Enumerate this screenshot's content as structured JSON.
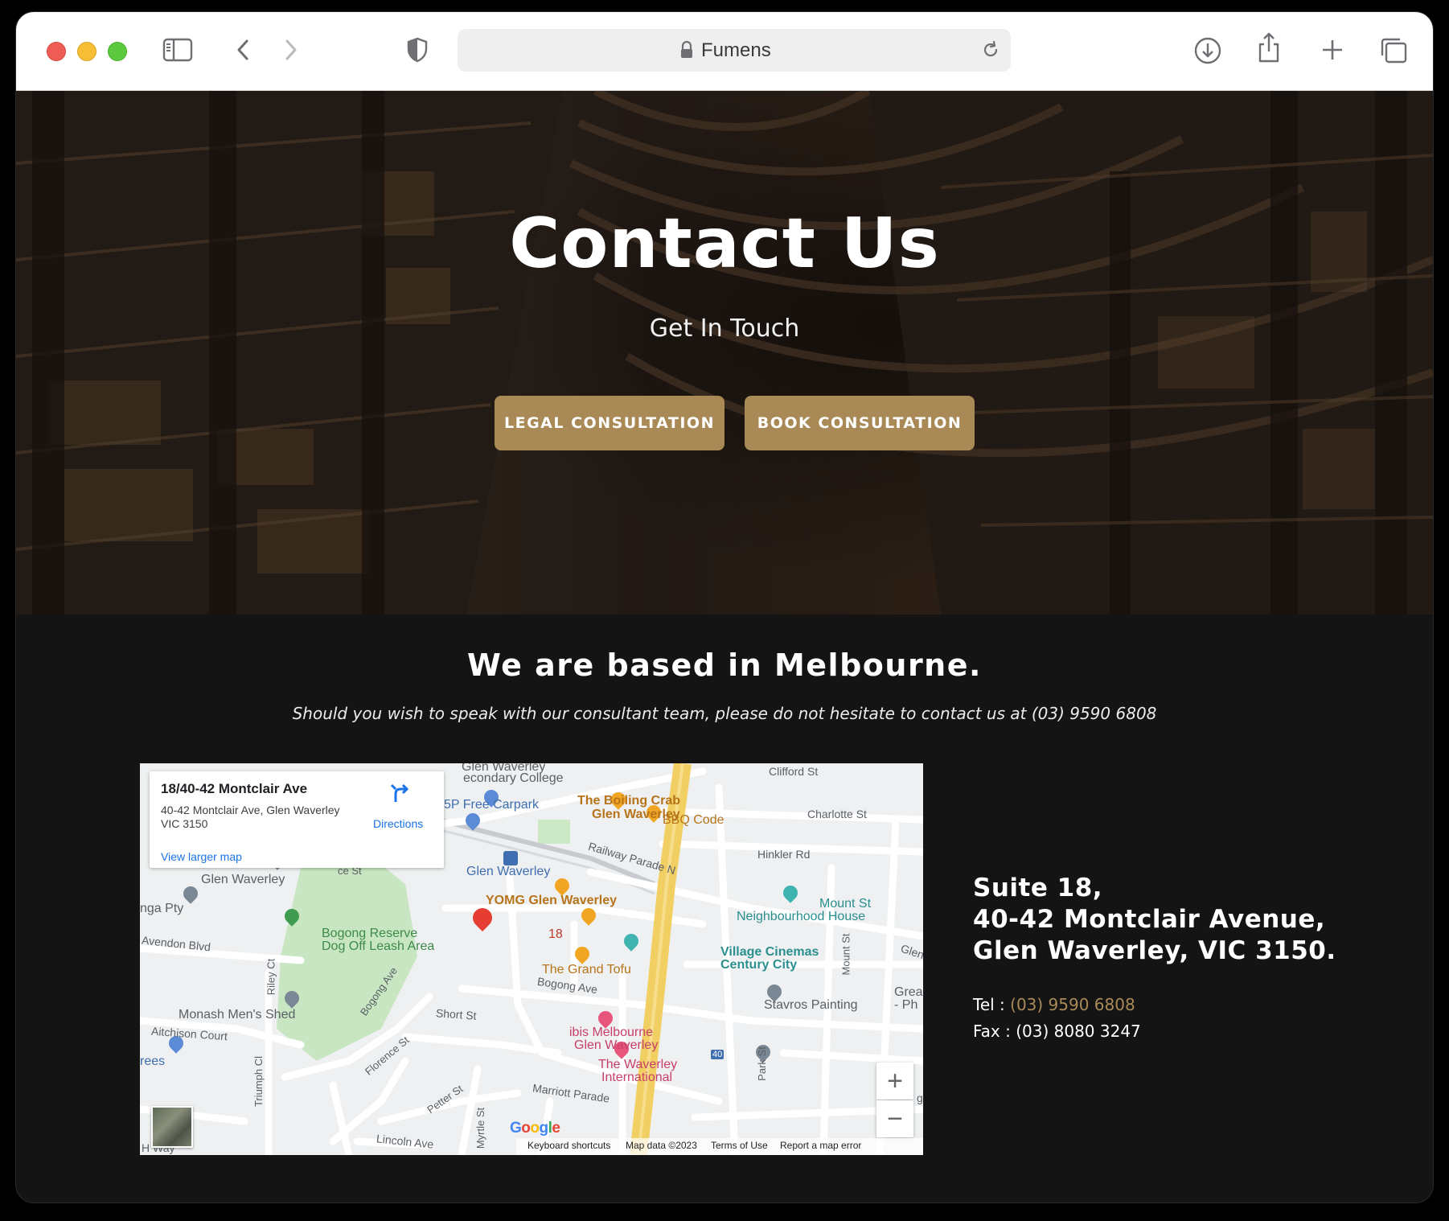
{
  "browser": {
    "url_title": "Fumens",
    "icons": [
      "sidebar-icon",
      "back-icon",
      "forward-icon",
      "shield-icon",
      "lock-icon",
      "reload-icon",
      "download-icon",
      "share-icon",
      "new-tab-icon",
      "tabs-overview-icon"
    ]
  },
  "hero": {
    "title": "Contact Us",
    "subtitle": "Get In Touch",
    "buttons": {
      "legal": "LEGAL CONSULTATION",
      "book": "BOOK CONSULTATION"
    },
    "accent_color": "#a98a56"
  },
  "section": {
    "title": "We are based in Melbourne.",
    "description": "Should you wish to speak with our consultant team, please do not hesitate to contact us at (03) 9590 6808"
  },
  "map": {
    "infobox": {
      "title": "18/40-42 Montclair Ave",
      "address": "40-42 Montclair Ave, Glen Waverley VIC 3150",
      "directions": "Directions",
      "larger_map": "View larger map"
    },
    "labels": {
      "glen_waverley_secondary": "Glen Waverley",
      "secondary_college": "econdary College",
      "carpark": "5P Free Carpark",
      "boiling_crab_1": "The Boiling Crab",
      "boiling_crab_2": "Glen Waverley",
      "bbq_code": "BBQ Code",
      "clifford": "Clifford St",
      "charlotte": "Charlotte St",
      "hinkler": "Hinkler Rd",
      "railway": "Railway Parade N",
      "station": "Glen Waverley",
      "glen_waverley_west": "Glen Waverley",
      "ce_st": "ce St",
      "nga_pty": "nga Pty",
      "yomg": "YOMG Glen Waverley",
      "mount_st_nh": "Mount St",
      "neighbourhood_house": "Neighbourhood House",
      "avendon": "Avendon Blvd",
      "bogong_reserve_1": "Bogong Reserve",
      "bogong_reserve_2": "Dog Off Leash Area",
      "pin_label": "18",
      "village_1": "Village Cinemas",
      "village_2": "Century City",
      "glen_edge": "Glen",
      "grand_tofu": "The Grand Tofu",
      "bogong_ave": "Bogong Ave",
      "riley": "Riley Ct",
      "bogong_ave_diag": "Bogong Ave",
      "mount_st": "Mount St",
      "great_ph_1": "Grea",
      "great_ph_2": "- Ph",
      "monash": "Monash Men's Shed",
      "short_st": "Short St",
      "stavros": "Stavros Painting",
      "aitchison": "Aitchison Court",
      "florence": "Florence St",
      "triumph": "Triumph Cl",
      "ibis_1": "ibis Melbourne",
      "ibis_2": "Glen Waverley",
      "park_st": "Park St",
      "route": "40",
      "trees": "rees",
      "waverley_int_1": "The Waverley",
      "waverley_int_2": "International",
      "petter": "Petter St",
      "marriott": "Marriott Parade",
      "myrtle": "Myrtle St",
      "lincoln": "Lincoln Ave",
      "hillcrest": "H        Way",
      "g_edge": "g"
    },
    "zoom_in": "+",
    "zoom_out": "−",
    "google": "Google",
    "attribution": {
      "shortcuts": "Keyboard shortcuts",
      "data": "Map data ©2023",
      "terms": "Terms of Use",
      "report": "Report a map error"
    }
  },
  "contact": {
    "line1": "Suite 18,",
    "line2": "40-42 Montclair Avenue,",
    "line3": "Glen Waverley, VIC 3150.",
    "tel_label": "Tel : ",
    "tel_number": "(03) 9590 6808",
    "fax_label": "Fax : ",
    "fax_number": "(03) 8080 3247"
  }
}
